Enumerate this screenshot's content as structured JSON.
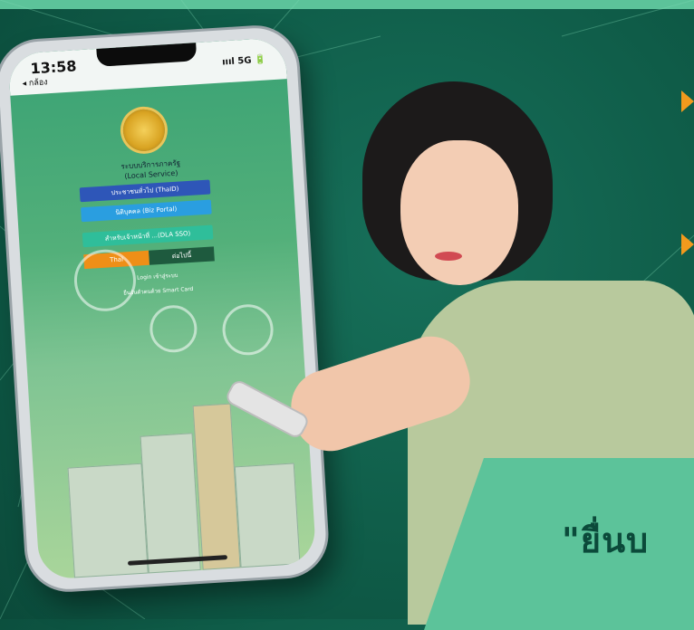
{
  "phone": {
    "status": {
      "time": "13:58",
      "back_label": "◂ กล้อง",
      "network": "ıııl 5G 🔋"
    },
    "app_title_line1": "ระบบบริการภาครัฐ",
    "app_title_line2": "(Local Service)",
    "buttons": [
      {
        "label": "ประชาชนทั่วไป (ThaID)"
      },
      {
        "label": "นิติบุคคล (Biz Portal)"
      },
      {
        "label": "สำหรับเจ้าหน้าที่ ...(DLA SSO)"
      }
    ],
    "segment": {
      "left": "ThaI",
      "right": "ต่อไปนี้"
    },
    "links": {
      "line1": "Login เข้าสู่ระบบ",
      "line2": "ยืนยันตัวตนด้วย Smart Card"
    }
  },
  "banner": {
    "text": "\"ยื่นบ"
  },
  "colors": {
    "accent": "#5cc39a",
    "bg": "#0f5c48",
    "orange": "#f19a1d"
  }
}
